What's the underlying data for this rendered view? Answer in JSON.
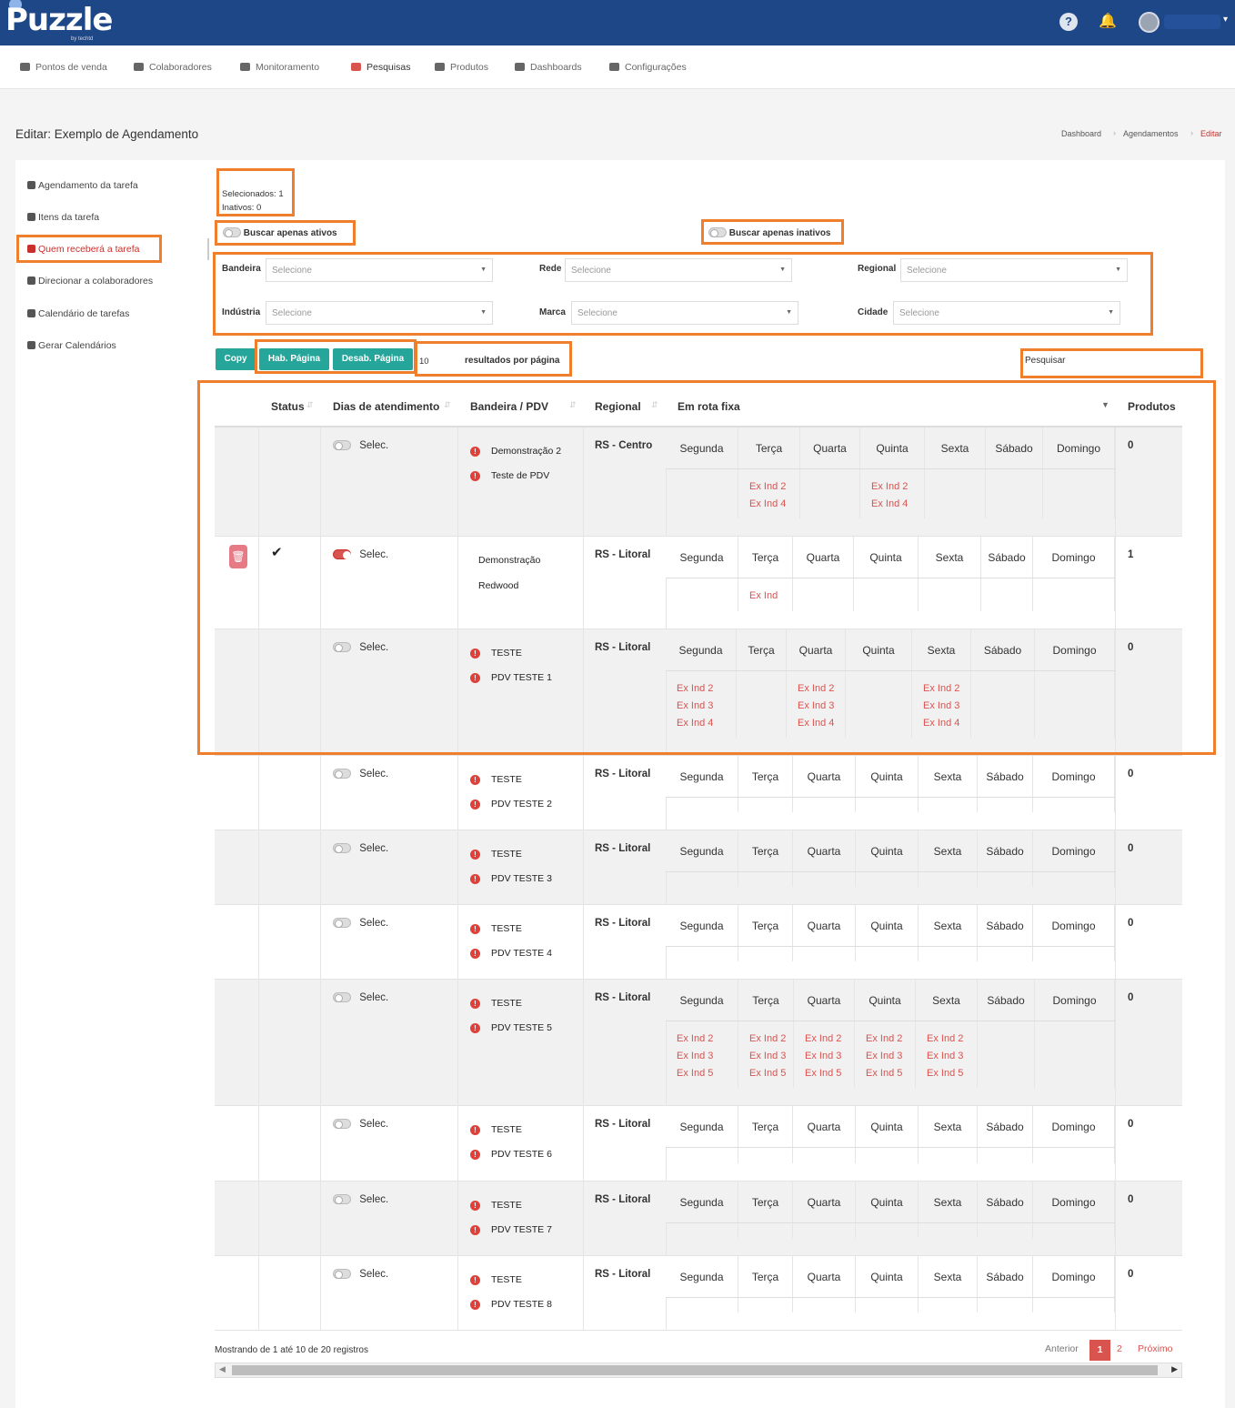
{
  "app": {
    "logo": "Puzzle",
    "logo_sub": "by techtd",
    "help_icon": "?",
    "bell_icon": "bell"
  },
  "nav": [
    {
      "label": "Pontos de venda",
      "icon": "store-icon"
    },
    {
      "label": "Colaboradores",
      "icon": "users-icon"
    },
    {
      "label": "Monitoramento",
      "icon": "monitor-icon"
    },
    {
      "label": "Pesquisas",
      "icon": "survey-icon"
    },
    {
      "label": "Produtos",
      "icon": "barcode-icon"
    },
    {
      "label": "Dashboards",
      "icon": "chart-icon"
    },
    {
      "label": "Configurações",
      "icon": "gears-icon"
    }
  ],
  "page": {
    "title": "Editar: Exemplo de Agendamento"
  },
  "breadcrumb": [
    "Dashboard",
    "Agendamentos",
    "Editar"
  ],
  "sidebar": [
    {
      "label": "Agendamento da tarefa"
    },
    {
      "label": "Itens da tarefa"
    },
    {
      "label": "Quem receberá a tarefa"
    },
    {
      "label": "Direcionar a colaboradores"
    },
    {
      "label": "Calendário de tarefas"
    },
    {
      "label": "Gerar Calendários"
    }
  ],
  "counts": {
    "selected": "Selecionados: 1",
    "inactive": "Inativos: 0"
  },
  "toggles": {
    "active_only": "Buscar apenas ativos",
    "inactive_only": "Buscar apenas inativos"
  },
  "filters": {
    "bandeira": {
      "label": "Bandeira",
      "placeholder": "Selecione"
    },
    "rede": {
      "label": "Rede",
      "placeholder": "Selecione"
    },
    "regional": {
      "label": "Regional",
      "placeholder": "Selecione"
    },
    "industria": {
      "label": "Indústria",
      "placeholder": "Selecione"
    },
    "marca": {
      "label": "Marca",
      "placeholder": "Selecione"
    },
    "cidade": {
      "label": "Cidade",
      "placeholder": "Selecione"
    }
  },
  "toolbar": {
    "copy": "Copy",
    "hab": "Hab. Página",
    "desab": "Desab. Página",
    "per_page_value": "10",
    "per_page_label": "resultados por página",
    "search_label": "Pesquisar"
  },
  "table": {
    "headers": {
      "status": "Status",
      "dias": "Dias de atendimento",
      "bandeira": "Bandeira / PDV",
      "regional": "Regional",
      "rota": "Em rota fixa",
      "produtos": "Produtos"
    },
    "selec_label": "Selec.",
    "rows": [
      {
        "checked": false,
        "active": false,
        "pdv": [
          "Demonstração 2",
          "Teste de PDV"
        ],
        "warn": true,
        "regional": "RS - Centro",
        "days": [
          "Segunda",
          "Terça",
          "Quarta",
          "Quinta",
          "Sexta",
          "Sábado",
          "Domingo"
        ],
        "inds": [
          [],
          [
            "Ex Ind 2",
            "Ex Ind 4"
          ],
          [],
          [
            "Ex Ind 2",
            "Ex Ind 4"
          ],
          [],
          [],
          []
        ],
        "produtos": "0"
      },
      {
        "checked": true,
        "active": true,
        "pdv": [
          "Demonstração",
          "Redwood"
        ],
        "warn": false,
        "regional": "RS - Litoral",
        "days": [
          "Segunda",
          "Terça",
          "Quarta",
          "Quinta",
          "Sexta",
          "Sábado",
          "Domingo"
        ],
        "inds": [
          [],
          [
            "Ex Ind"
          ],
          [],
          [],
          [],
          [],
          []
        ],
        "produtos": "1"
      },
      {
        "checked": false,
        "active": false,
        "pdv": [
          "TESTE",
          "PDV TESTE 1"
        ],
        "warn": true,
        "regional": "RS - Litoral",
        "days": [
          "Segunda",
          "Terça",
          "Quarta",
          "Quinta",
          "Sexta",
          "Sábado",
          "Domingo"
        ],
        "inds": [
          [
            "Ex Ind 2",
            "Ex Ind 3",
            "Ex Ind 4"
          ],
          [],
          [
            "Ex Ind 2",
            "Ex Ind 3",
            "Ex Ind 4"
          ],
          [],
          [
            "Ex Ind 2",
            "Ex Ind 3",
            "Ex Ind 4"
          ],
          [],
          []
        ],
        "produtos": "0"
      },
      {
        "checked": false,
        "active": false,
        "pdv": [
          "TESTE",
          "PDV TESTE 2"
        ],
        "warn": true,
        "regional": "RS - Litoral",
        "days": [
          "Segunda",
          "Terça",
          "Quarta",
          "Quinta",
          "Sexta",
          "Sábado",
          "Domingo"
        ],
        "inds": [
          [],
          [],
          [],
          [],
          [],
          [],
          []
        ],
        "produtos": "0"
      },
      {
        "checked": false,
        "active": false,
        "pdv": [
          "TESTE",
          "PDV TESTE 3"
        ],
        "warn": true,
        "regional": "RS - Litoral",
        "days": [
          "Segunda",
          "Terça",
          "Quarta",
          "Quinta",
          "Sexta",
          "Sábado",
          "Domingo"
        ],
        "inds": [
          [],
          [],
          [],
          [],
          [],
          [],
          []
        ],
        "produtos": "0"
      },
      {
        "checked": false,
        "active": false,
        "pdv": [
          "TESTE",
          "PDV TESTE 4"
        ],
        "warn": true,
        "regional": "RS - Litoral",
        "days": [
          "Segunda",
          "Terça",
          "Quarta",
          "Quinta",
          "Sexta",
          "Sábado",
          "Domingo"
        ],
        "inds": [
          [],
          [],
          [],
          [],
          [],
          [],
          []
        ],
        "produtos": "0"
      },
      {
        "checked": false,
        "active": false,
        "pdv": [
          "TESTE",
          "PDV TESTE 5"
        ],
        "warn": true,
        "regional": "RS - Litoral",
        "days": [
          "Segunda",
          "Terça",
          "Quarta",
          "Quinta",
          "Sexta",
          "Sábado",
          "Domingo"
        ],
        "inds": [
          [
            "Ex Ind 2",
            "Ex Ind 3",
            "Ex Ind 5"
          ],
          [
            "Ex Ind 2",
            "Ex Ind 3",
            "Ex Ind 5"
          ],
          [
            "Ex Ind 2",
            "Ex Ind 3",
            "Ex Ind 5"
          ],
          [
            "Ex Ind 2",
            "Ex Ind 3",
            "Ex Ind 5"
          ],
          [
            "Ex Ind 2",
            "Ex Ind 3",
            "Ex Ind 5"
          ],
          [],
          []
        ],
        "produtos": "0"
      },
      {
        "checked": false,
        "active": false,
        "pdv": [
          "TESTE",
          "PDV TESTE 6"
        ],
        "warn": true,
        "regional": "RS - Litoral",
        "days": [
          "Segunda",
          "Terça",
          "Quarta",
          "Quinta",
          "Sexta",
          "Sábado",
          "Domingo"
        ],
        "inds": [
          [],
          [],
          [],
          [],
          [],
          [],
          []
        ],
        "produtos": "0"
      },
      {
        "checked": false,
        "active": false,
        "pdv": [
          "TESTE",
          "PDV TESTE 7"
        ],
        "warn": true,
        "regional": "RS - Litoral",
        "days": [
          "Segunda",
          "Terça",
          "Quarta",
          "Quinta",
          "Sexta",
          "Sábado",
          "Domingo"
        ],
        "inds": [
          [],
          [],
          [],
          [],
          [],
          [],
          []
        ],
        "produtos": "0"
      },
      {
        "checked": false,
        "active": false,
        "pdv": [
          "TESTE",
          "PDV TESTE 8"
        ],
        "warn": true,
        "regional": "RS - Litoral",
        "days": [
          "Segunda",
          "Terça",
          "Quarta",
          "Quinta",
          "Sexta",
          "Sábado",
          "Domingo"
        ],
        "inds": [
          [],
          [],
          [],
          [],
          [],
          [],
          []
        ],
        "produtos": "0"
      }
    ]
  },
  "pagination": {
    "info": "Mostrando de 1 até 10 de 20 registros",
    "prev": "Anterior",
    "pages": [
      "1",
      "2"
    ],
    "current": "1",
    "next": "Próximo"
  },
  "colors": {
    "header": "#1e4788",
    "accent": "#d9534f",
    "teal": "#26a69a",
    "highlight": "#f07f2d"
  }
}
